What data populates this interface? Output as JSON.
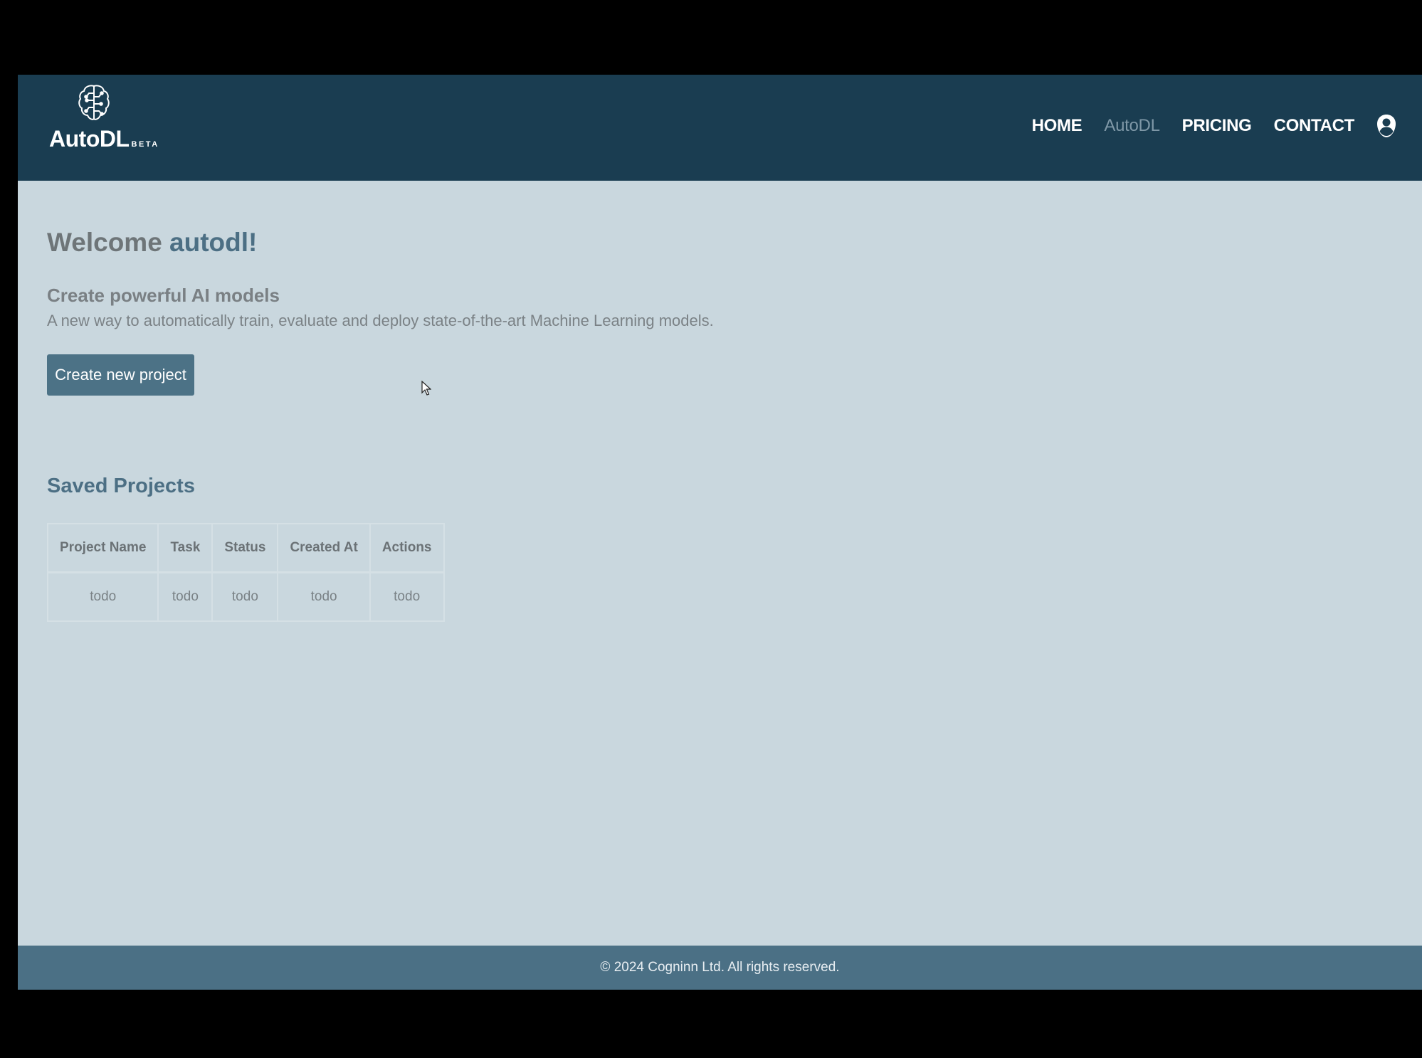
{
  "brand": {
    "name": "AutoDL",
    "badge": "BETA",
    "icon": "brain-circuit-icon"
  },
  "nav": {
    "items": [
      {
        "label": "HOME",
        "active": false
      },
      {
        "label": "AutoDL",
        "active": true
      },
      {
        "label": "PRICING",
        "active": false
      },
      {
        "label": "CONTACT",
        "active": false
      }
    ],
    "user_icon": "user-account-icon"
  },
  "main": {
    "welcome_prefix": "Welcome ",
    "username": "autodl!",
    "tagline": "Create powerful AI models",
    "description": "A new way to automatically train, evaluate and deploy state-of-the-art Machine Learning models.",
    "create_button": "Create new project"
  },
  "projects": {
    "title": "Saved Projects",
    "columns": [
      "Project Name",
      "Task",
      "Status",
      "Created At",
      "Actions"
    ],
    "rows": [
      [
        "todo",
        "todo",
        "todo",
        "todo",
        "todo"
      ]
    ]
  },
  "footer": {
    "text": "© 2024 Cogninn Ltd. All rights reserved."
  },
  "colors": {
    "header_bg": "#1a3d51",
    "page_bg": "#c9d7de",
    "accent": "#4c7286",
    "footer_bg": "#4b7085",
    "nav_active": "#7f98a7"
  }
}
